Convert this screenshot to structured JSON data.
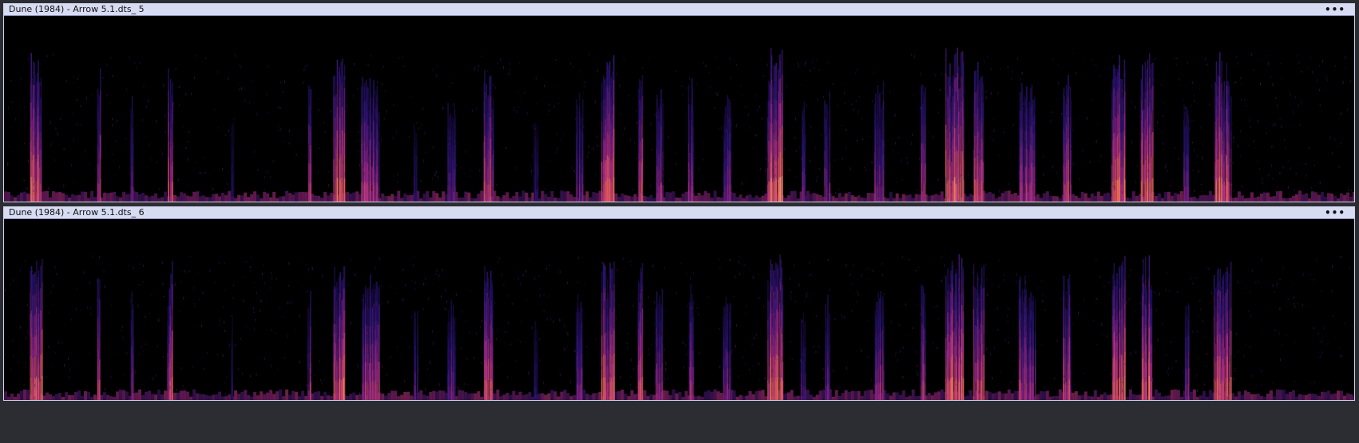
{
  "tracks": [
    {
      "name": "Dune (1984) - Arrow 5.1.dts_ 5",
      "menu_label": "•••",
      "seed": 5
    },
    {
      "name": "Dune (1984) - Arrow 5.1.dts_ 6",
      "menu_label": "•••",
      "seed": 6
    }
  ],
  "colors": {
    "header_bg": "#d7dcf3",
    "spectrogram_low": "#000000",
    "spectrogram_mid": "#3b1c8c",
    "spectrogram_high": "#c23d80",
    "spectrogram_peak": "#fcdc82"
  },
  "view": {
    "mode": "spectrogram",
    "colormap": "magma"
  }
}
